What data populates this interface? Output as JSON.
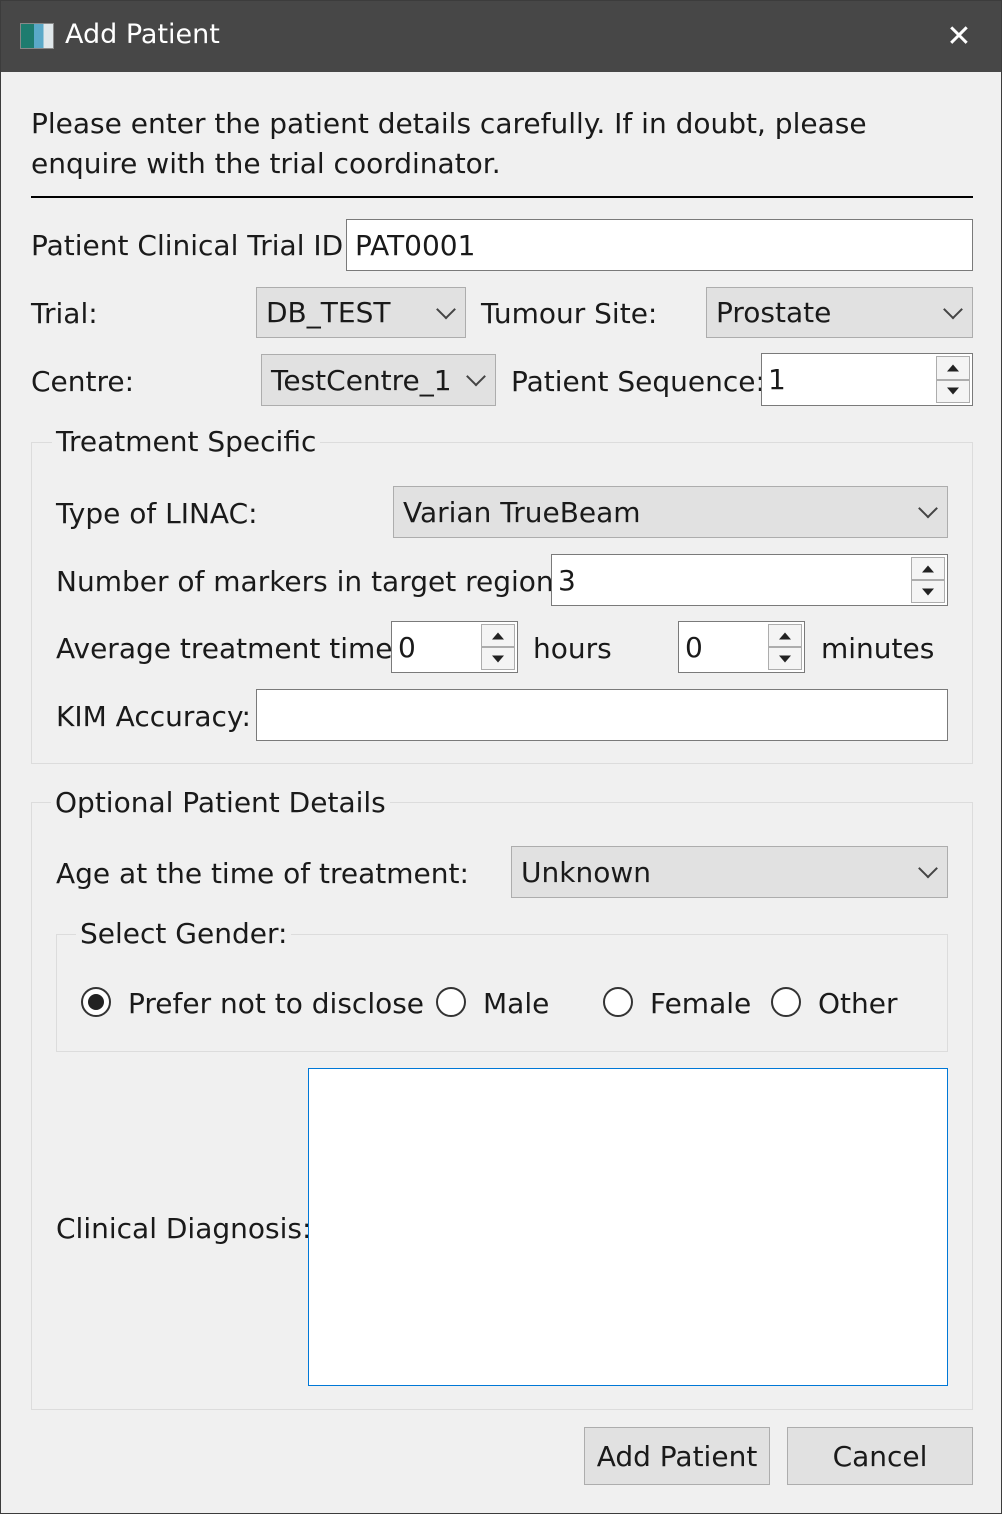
{
  "window": {
    "title": "Add Patient",
    "icon": "app-icon",
    "close_icon": "close-icon",
    "close_glyph": "✕"
  },
  "intro": {
    "text": "Please enter the patient details carefully. If in doubt, please enquire with the trial coordinator."
  },
  "patient_id": {
    "label": "Patient Clinical Trial ID:",
    "value": "PAT0001"
  },
  "trial": {
    "label": "Trial:",
    "value": "DB_TEST"
  },
  "tumour_site": {
    "label": "Tumour Site:",
    "value": "Prostate"
  },
  "centre": {
    "label": "Centre:",
    "value": "TestCentre_1"
  },
  "patient_sequence": {
    "label": "Patient Sequence:",
    "value": "1"
  },
  "treatment": {
    "title": "Treatment Specific",
    "linac_label": "Type of LINAC:",
    "linac_value": "Varian TrueBeam",
    "markers_label": "Number of markers in target region:",
    "markers_value": "3",
    "time_label": "Average treatment time:",
    "hours_value": "0",
    "hours_unit": "hours",
    "minutes_value": "0",
    "minutes_unit": "minutes",
    "kim_label": "KIM Accuracy:",
    "kim_value": ""
  },
  "optional": {
    "title": "Optional Patient Details",
    "age_label": "Age at the time of treatment:",
    "age_value": "Unknown",
    "gender": {
      "title": "Select Gender:",
      "options": [
        "Prefer not to disclose",
        "Male",
        "Female",
        "Other"
      ],
      "selected": "Prefer not to disclose"
    },
    "diagnosis_label": "Clinical Diagnosis:",
    "diagnosis_value": ""
  },
  "buttons": {
    "add": "Add Patient",
    "cancel": "Cancel"
  }
}
